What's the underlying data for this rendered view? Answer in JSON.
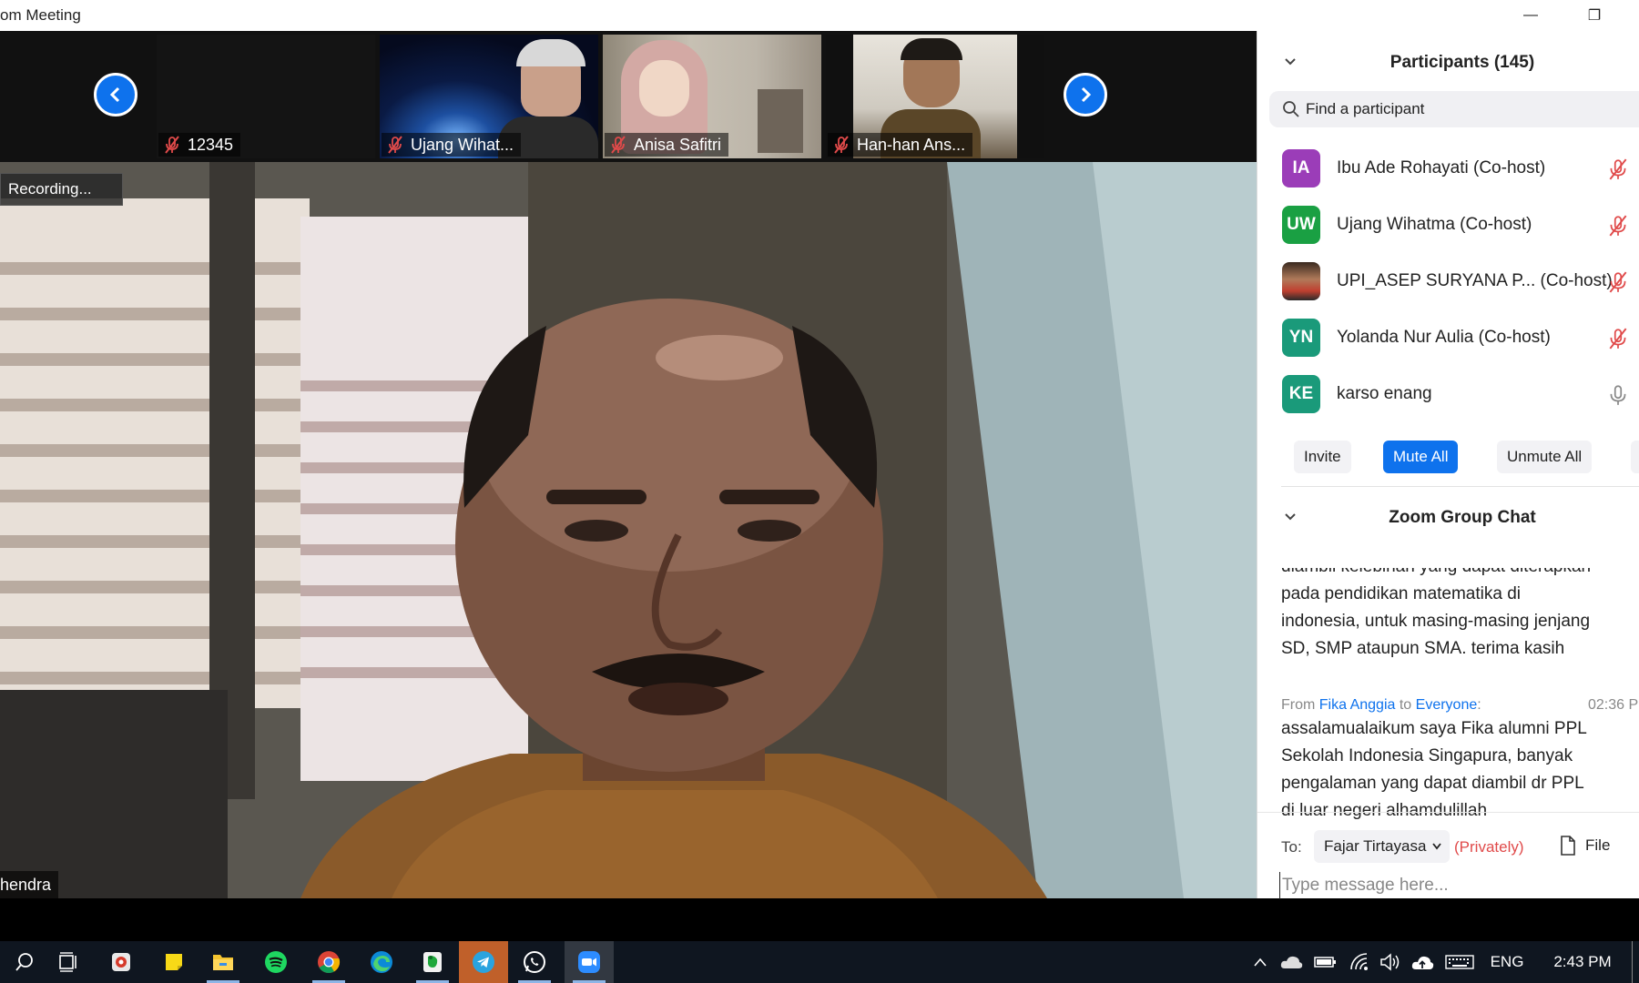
{
  "window": {
    "title": "om Meeting",
    "minimize_glyph": "—",
    "restore_glyph": "❐"
  },
  "thumbnails": [
    {
      "name": "12345"
    },
    {
      "name": "Ujang Wihat..."
    },
    {
      "name": "Anisa Safitri"
    },
    {
      "name": "Han-han Ans..."
    }
  ],
  "main_video": {
    "recording_label": "Recording...",
    "speaker_name": "hendra"
  },
  "participants": {
    "title": "Participants (145)",
    "search_placeholder": "Find a participant",
    "list": [
      {
        "initials": "IA",
        "name": "Ibu Ade Rohayati (Co-host)",
        "color": "#9b3db8",
        "muted": true
      },
      {
        "initials": "UW",
        "name": "Ujang Wihatma (Co-host)",
        "color": "#1aa043",
        "muted": true
      },
      {
        "initials": "",
        "name": "UPI_ASEP SURYANA P...  (Co-host)",
        "color": "#7a5a3a",
        "muted": true
      },
      {
        "initials": "YN",
        "name": "Yolanda Nur Aulia (Co-host)",
        "color": "#1a9a7a",
        "muted": true
      },
      {
        "initials": "KE",
        "name": "karso enang",
        "color": "#1a9a7a",
        "muted": false
      }
    ],
    "actions": {
      "invite": "Invite",
      "mute_all": "Mute All",
      "unmute_all": "Unmute All"
    }
  },
  "chat": {
    "title": "Zoom Group Chat",
    "partial_top": "diambil kelebihan yang dapat diterapkan",
    "prev_message_lines": [
      "pada pendidikan matematika di",
      "indonesia, untuk masing-masing jenjang",
      "SD, SMP ataupun SMA. terima kasih"
    ],
    "message": {
      "from_prefix": "From",
      "sender": "Fika Anggia",
      "to_word": "to",
      "recipient": "Everyone",
      "colon": ":",
      "time": "02:36 P",
      "lines": [
        "assalamualaikum saya Fika alumni PPL",
        "Sekolah Indonesia Singapura, banyak",
        "pengalaman yang dapat diambil dr PPL",
        "di luar negeri alhamdulillah"
      ]
    },
    "to_label": "To:",
    "to_value": "Fajar Tirtayasa",
    "privately": "(Privately)",
    "file_label": "File",
    "input_placeholder": "Type message here..."
  },
  "taskbar": {
    "language": "ENG",
    "time": "2:43 PM"
  }
}
